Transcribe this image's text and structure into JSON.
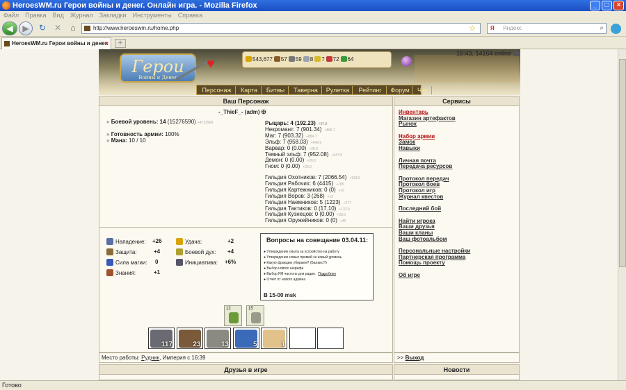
{
  "window": {
    "title": "HeroesWM.ru Герои войны и денег. Онлайн игра. - Mozilla Firefox"
  },
  "menu": [
    "Файл",
    "Правка",
    "Вид",
    "Журнал",
    "Закладки",
    "Инструменты",
    "Справка"
  ],
  "nav": {
    "url": "http://www.heroeswm.ru/home.php",
    "search_placeholder": "Яндекс",
    "search_engine": "Я"
  },
  "tab": {
    "title": "HeroesWM.ru Герои войны и денег. ..."
  },
  "game": {
    "logo": "Герои",
    "logo_sub": "Войны и Денег",
    "time_online": "16:43, 14164 online",
    "resources": [
      {
        "value": "543,677",
        "icon": "gold-icon",
        "color": "#d9a400"
      },
      {
        "value": "57",
        "icon": "wood-icon",
        "color": "#8a5a2b"
      },
      {
        "value": "59",
        "icon": "ore-icon",
        "color": "#777777"
      },
      {
        "value": "8",
        "icon": "mercury-icon",
        "color": "#9aa3ad"
      },
      {
        "value": "7",
        "icon": "sulfur-icon",
        "color": "#d9b92a"
      },
      {
        "value": "72",
        "icon": "crystal-icon",
        "color": "#c23a3a"
      },
      {
        "value": "64",
        "icon": "gem-icon",
        "color": "#3a9a3a"
      }
    ],
    "tabs": [
      "Персонаж",
      "Карта",
      "Битвы",
      "Таверна",
      "Рулетка",
      "Рейтинг",
      "Форум",
      "Чат"
    ]
  },
  "character": {
    "header": "Ваш Персонаж",
    "name": "-_ThieF_- (adm)",
    "combat_label": "Боевой уровень:",
    "combat_level": "14",
    "combat_xp": "(15276590)",
    "combat_delta": "+4723969",
    "readiness_label": "Готовность армии:",
    "readiness": "100%",
    "mana_label": "Мана:",
    "mana": "10 / 10",
    "factions": [
      {
        "text": "Рыцарь: 4 (192.23)",
        "delta": "+87.8",
        "bold": true
      },
      {
        "text": "Некромант: 7 (901.34)",
        "delta": "+886.7"
      },
      {
        "text": "Маг: 7 (903.32)",
        "delta": "+884.7"
      },
      {
        "text": "Эльф: 7 (958.03)",
        "delta": "+642.0"
      },
      {
        "text": "Варвар: 0 (0.00)",
        "delta": "+20.0"
      },
      {
        "text": "Темный эльф: 7 (952.08)",
        "delta": "+647.9"
      },
      {
        "text": "Демон: 0 (0.00)",
        "delta": "+20.0"
      },
      {
        "text": "Гном: 0 (0.00)",
        "delta": "+20.0"
      }
    ],
    "guilds": [
      {
        "text": "Гильдия Охотников: 7 (2066.54)",
        "delta": "+933.5"
      },
      {
        "text": "Гильдия Рабочих: 6 (4415)",
        "delta": "+185"
      },
      {
        "text": "Гильдия Картежников: 0 (0)",
        "delta": "+10"
      },
      {
        "text": "Гильдия Воров: 3 (268)",
        "delta": "+12"
      },
      {
        "text": "Гильдия Наемников: 5 (1223)",
        "delta": "+277"
      },
      {
        "text": "Гильдия Тактиков: 0 (17.10)",
        "delta": "+132.9"
      },
      {
        "text": "Гильдия Кузнецов: 0 (0.00)",
        "delta": "+30.0"
      },
      {
        "text": "Гильдия Оружейников: 0 (0)",
        "delta": "+40"
      }
    ],
    "plus": "(+)"
  },
  "stats": [
    {
      "label": "Нападение:",
      "value": "+26",
      "icon": "sword-icon",
      "color": "#5b6fa8"
    },
    {
      "label": "Защита:",
      "value": "+4",
      "icon": "shield-icon",
      "color": "#8a6b3a"
    },
    {
      "label": "Сила магии:",
      "value": "0",
      "icon": "wand-icon",
      "color": "#3a5ab8"
    },
    {
      "label": "Знания:",
      "value": "+1",
      "icon": "book-icon",
      "color": "#a0522d"
    },
    {
      "label": "Удача:",
      "value": "+2",
      "icon": "rainbow-icon",
      "color": "#d9a400"
    },
    {
      "label": "Боевой дух:",
      "value": "+4",
      "icon": "wings-icon",
      "color": "#b0a030"
    },
    {
      "label": "Инициатива:",
      "value": "+6%",
      "icon": "hourglass-icon",
      "color": "#555566"
    }
  ],
  "meeting": {
    "title": "Вопросы на совещание 03.04.11:",
    "items": [
      "Утверждение опыта за устройство на работу",
      "Утверждение новых премий за новый уровень",
      "Какую фракцию убираем? (Балакс!!!)",
      "Выбор нового шерифа",
      "Выбор FM частоты для радио.",
      "Отчет от нового админа"
    ],
    "more": "Подробнее",
    "footer": "В 15-00 msk"
  },
  "artifacts": [
    {
      "count": "12",
      "color": "#6c9a3a"
    },
    {
      "count": "15",
      "color": "#9a9a8a"
    }
  ],
  "army": [
    {
      "count": "117",
      "color": "#6a6a72"
    },
    {
      "count": "23",
      "color": "#7a5a3a"
    },
    {
      "count": "13",
      "color": "#8a8a80"
    },
    {
      "count": "5",
      "color": "#3a6ab8"
    },
    {
      "count": "1",
      "color": "#e0c28a"
    },
    {
      "count": "",
      "color": "#ffffff"
    },
    {
      "count": "",
      "color": "#ffffff"
    }
  ],
  "work": {
    "label": "Место работы:",
    "place": "Рудник",
    "rest": ", Империя с 16:39"
  },
  "services": {
    "header": "Сервисы",
    "links": [
      {
        "label": "Инвентарь",
        "red": true
      },
      {
        "label": "Магазин артефактов"
      },
      {
        "label": "Рынок"
      },
      {
        "label": "Набор армии",
        "red": true
      },
      {
        "label": "Замок"
      },
      {
        "label": "Навыки"
      },
      {
        "label": "Личная почта"
      },
      {
        "label": "Передача ресурсов"
      },
      {
        "label": "Протокол передач"
      },
      {
        "label": "Протокол боев"
      },
      {
        "label": "Протокол игр"
      },
      {
        "label": "Журнал квестов"
      },
      {
        "label": "Последний бой"
      },
      {
        "label": "Найти игрока"
      },
      {
        "label": "Ваши друзья"
      },
      {
        "label": "Ваши кланы"
      },
      {
        "label": "Ваш фотоальбом"
      },
      {
        "label": "Персональные настройки"
      },
      {
        "label": "Партнерская программа"
      },
      {
        "label": "Помощь проекту"
      },
      {
        "label": "Об игре"
      }
    ],
    "exit_prefix": ">>",
    "exit": "Выход"
  },
  "friends": {
    "header": "Друзья в игре"
  },
  "news": {
    "header": "Новости"
  },
  "status": "Готово"
}
